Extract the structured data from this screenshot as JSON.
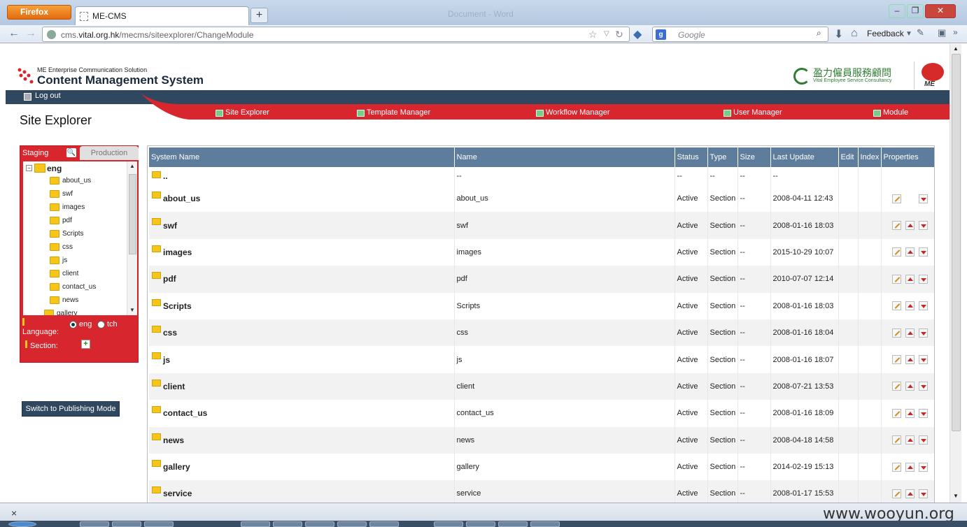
{
  "browser": {
    "firefox_label": "Firefox",
    "tab_title": "ME-CMS",
    "new_tab": "+",
    "ghost_text": "Document - Word",
    "url_prefix": "cms.",
    "url_domain": "vital.org.hk",
    "url_path": "/mecms/siteexplorer/ChangeModule",
    "search_placeholder": "Google",
    "search_engine_letter": "g",
    "feedback_label": "Feedback",
    "close_statusbar": "×",
    "watermark": "www.wooyun.org"
  },
  "header": {
    "logo_sub": "ME Enterprise Communication Solution",
    "logo_main": "Content Management System",
    "partner_cn": "盈力僱員服務顧問",
    "partner_en": "Vital Employee Service Consultancy",
    "me_logo": "ME",
    "logout": "Log out"
  },
  "menu": [
    {
      "label": "Site Explorer"
    },
    {
      "label": "Template Manager"
    },
    {
      "label": "Workflow Manager"
    },
    {
      "label": "User Manager"
    },
    {
      "label": "Module"
    }
  ],
  "page_title": "Site Explorer",
  "left_panel": {
    "tab_staging": "Staging",
    "tab_production": "Production",
    "tree_root": "eng",
    "tree_items": [
      "about_us",
      "swf",
      "images",
      "pdf",
      "Scripts",
      "css",
      "js",
      "client",
      "contact_us",
      "news",
      "gallery"
    ],
    "language_label": "Language:",
    "lang_eng": "eng",
    "lang_tch": "tch",
    "section_label": "Section:",
    "switch_button": "Switch to Publishing Mode"
  },
  "table": {
    "headers": [
      "System Name",
      "Name",
      "Status",
      "Type",
      "Size",
      "Last Update",
      "Edit",
      "Index",
      "Properties"
    ],
    "parent_row": {
      "system_name": "..",
      "name": "--",
      "status": "--",
      "type": "--",
      "size": "--",
      "last_update": "--"
    },
    "rows": [
      {
        "system_name": "about_us",
        "name": "about_us",
        "status": "Active",
        "type": "Section",
        "size": "--",
        "last_update": "2008-04-11 12:43"
      },
      {
        "system_name": "swf",
        "name": "swf",
        "status": "Active",
        "type": "Section",
        "size": "--",
        "last_update": "2008-01-16 18:03"
      },
      {
        "system_name": "images",
        "name": "images",
        "status": "Active",
        "type": "Section",
        "size": "--",
        "last_update": "2015-10-29 10:07"
      },
      {
        "system_name": "pdf",
        "name": "pdf",
        "status": "Active",
        "type": "Section",
        "size": "--",
        "last_update": "2010-07-07 12:14"
      },
      {
        "system_name": "Scripts",
        "name": "Scripts",
        "status": "Active",
        "type": "Section",
        "size": "--",
        "last_update": "2008-01-16 18:03"
      },
      {
        "system_name": "css",
        "name": "css",
        "status": "Active",
        "type": "Section",
        "size": "--",
        "last_update": "2008-01-16 18:04"
      },
      {
        "system_name": "js",
        "name": "js",
        "status": "Active",
        "type": "Section",
        "size": "--",
        "last_update": "2008-01-16 18:07"
      },
      {
        "system_name": "client",
        "name": "client",
        "status": "Active",
        "type": "Section",
        "size": "--",
        "last_update": "2008-07-21 13:53"
      },
      {
        "system_name": "contact_us",
        "name": "contact_us",
        "status": "Active",
        "type": "Section",
        "size": "--",
        "last_update": "2008-01-16 18:09"
      },
      {
        "system_name": "news",
        "name": "news",
        "status": "Active",
        "type": "Section",
        "size": "--",
        "last_update": "2008-04-18 14:58"
      },
      {
        "system_name": "gallery",
        "name": "gallery",
        "status": "Active",
        "type": "Section",
        "size": "--",
        "last_update": "2014-02-19 15:13"
      },
      {
        "system_name": "service",
        "name": "service",
        "status": "Active",
        "type": "Section",
        "size": "--",
        "last_update": "2008-01-17 15:53"
      }
    ]
  },
  "colors": {
    "accent_red": "#d7262e",
    "nav_dark": "#2f4860",
    "table_header": "#5e7d9c"
  }
}
